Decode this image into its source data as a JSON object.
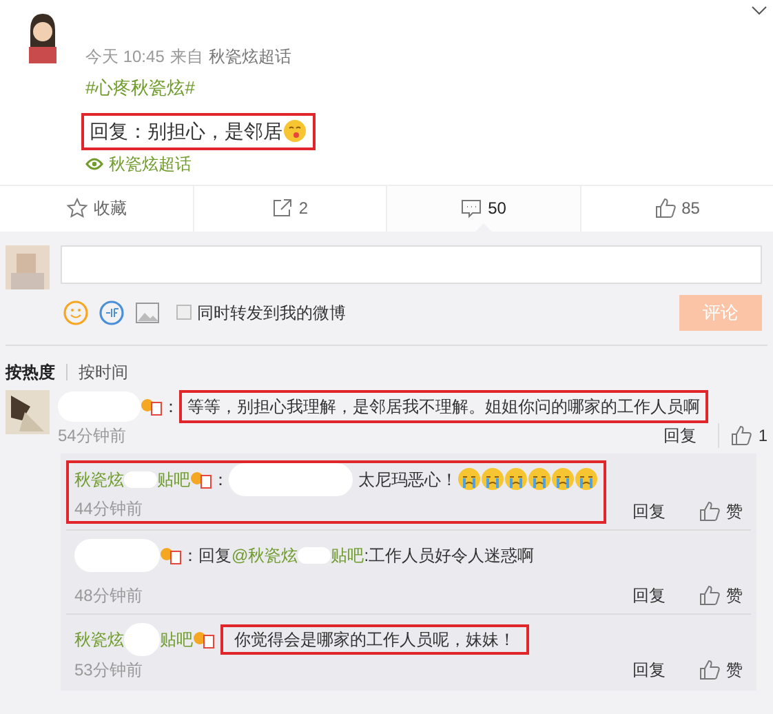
{
  "post": {
    "time": "今天 10:45",
    "source_prefix": "来自",
    "source": "秋瓷炫超话",
    "topic": "#心疼秋瓷炫#",
    "reply_text": "回复：别担心，是邻居",
    "highlighted": true,
    "supertopic": "秋瓷炫超话"
  },
  "actions": [
    {
      "kind": "favorite",
      "label": "收藏",
      "selected": false
    },
    {
      "kind": "repost",
      "label": "2",
      "selected": false
    },
    {
      "kind": "comment",
      "label": "50",
      "selected": true
    },
    {
      "kind": "like",
      "label": "85",
      "selected": false
    }
  ],
  "composer": {
    "checkbox_label": "同时转发到我的微博",
    "checked": false,
    "submit": "评论",
    "disabled": true
  },
  "sort_tabs": [
    {
      "label": "按热度",
      "selected": true
    },
    {
      "label": "按时间",
      "selected": false
    }
  ],
  "comment": {
    "separator": "：",
    "text": "等等，别担心我理解，是邻居我不理解。姐姐你问的哪家的工作人员啊",
    "highlighted": true,
    "time": "54分钟前",
    "reply": "回复",
    "likes": "1"
  },
  "replies": [
    {
      "kind": "emoji",
      "name": "秋瓷炫",
      "name_suffix": "贴吧",
      "separator": "：",
      "text": "太尼玛恶心！",
      "highlighted": true,
      "time": "44分钟前",
      "reply": "回复",
      "like": "赞"
    },
    {
      "kind": "mention",
      "prefix": "：回复",
      "mention": "@秋瓷炫",
      "mention_suffix": "贴吧",
      "text": ":工作人员好令人迷惑啊",
      "highlighted": false,
      "time": "48分钟前",
      "reply": "回复",
      "like": "赞"
    },
    {
      "kind": "plain",
      "name": "秋瓷炫",
      "name_suffix": "贴吧",
      "text": "你觉得会是哪家的工作人员呢，妹妹！",
      "highlighted": true,
      "time": "53分钟前",
      "reply": "回复",
      "like": "赞"
    }
  ]
}
